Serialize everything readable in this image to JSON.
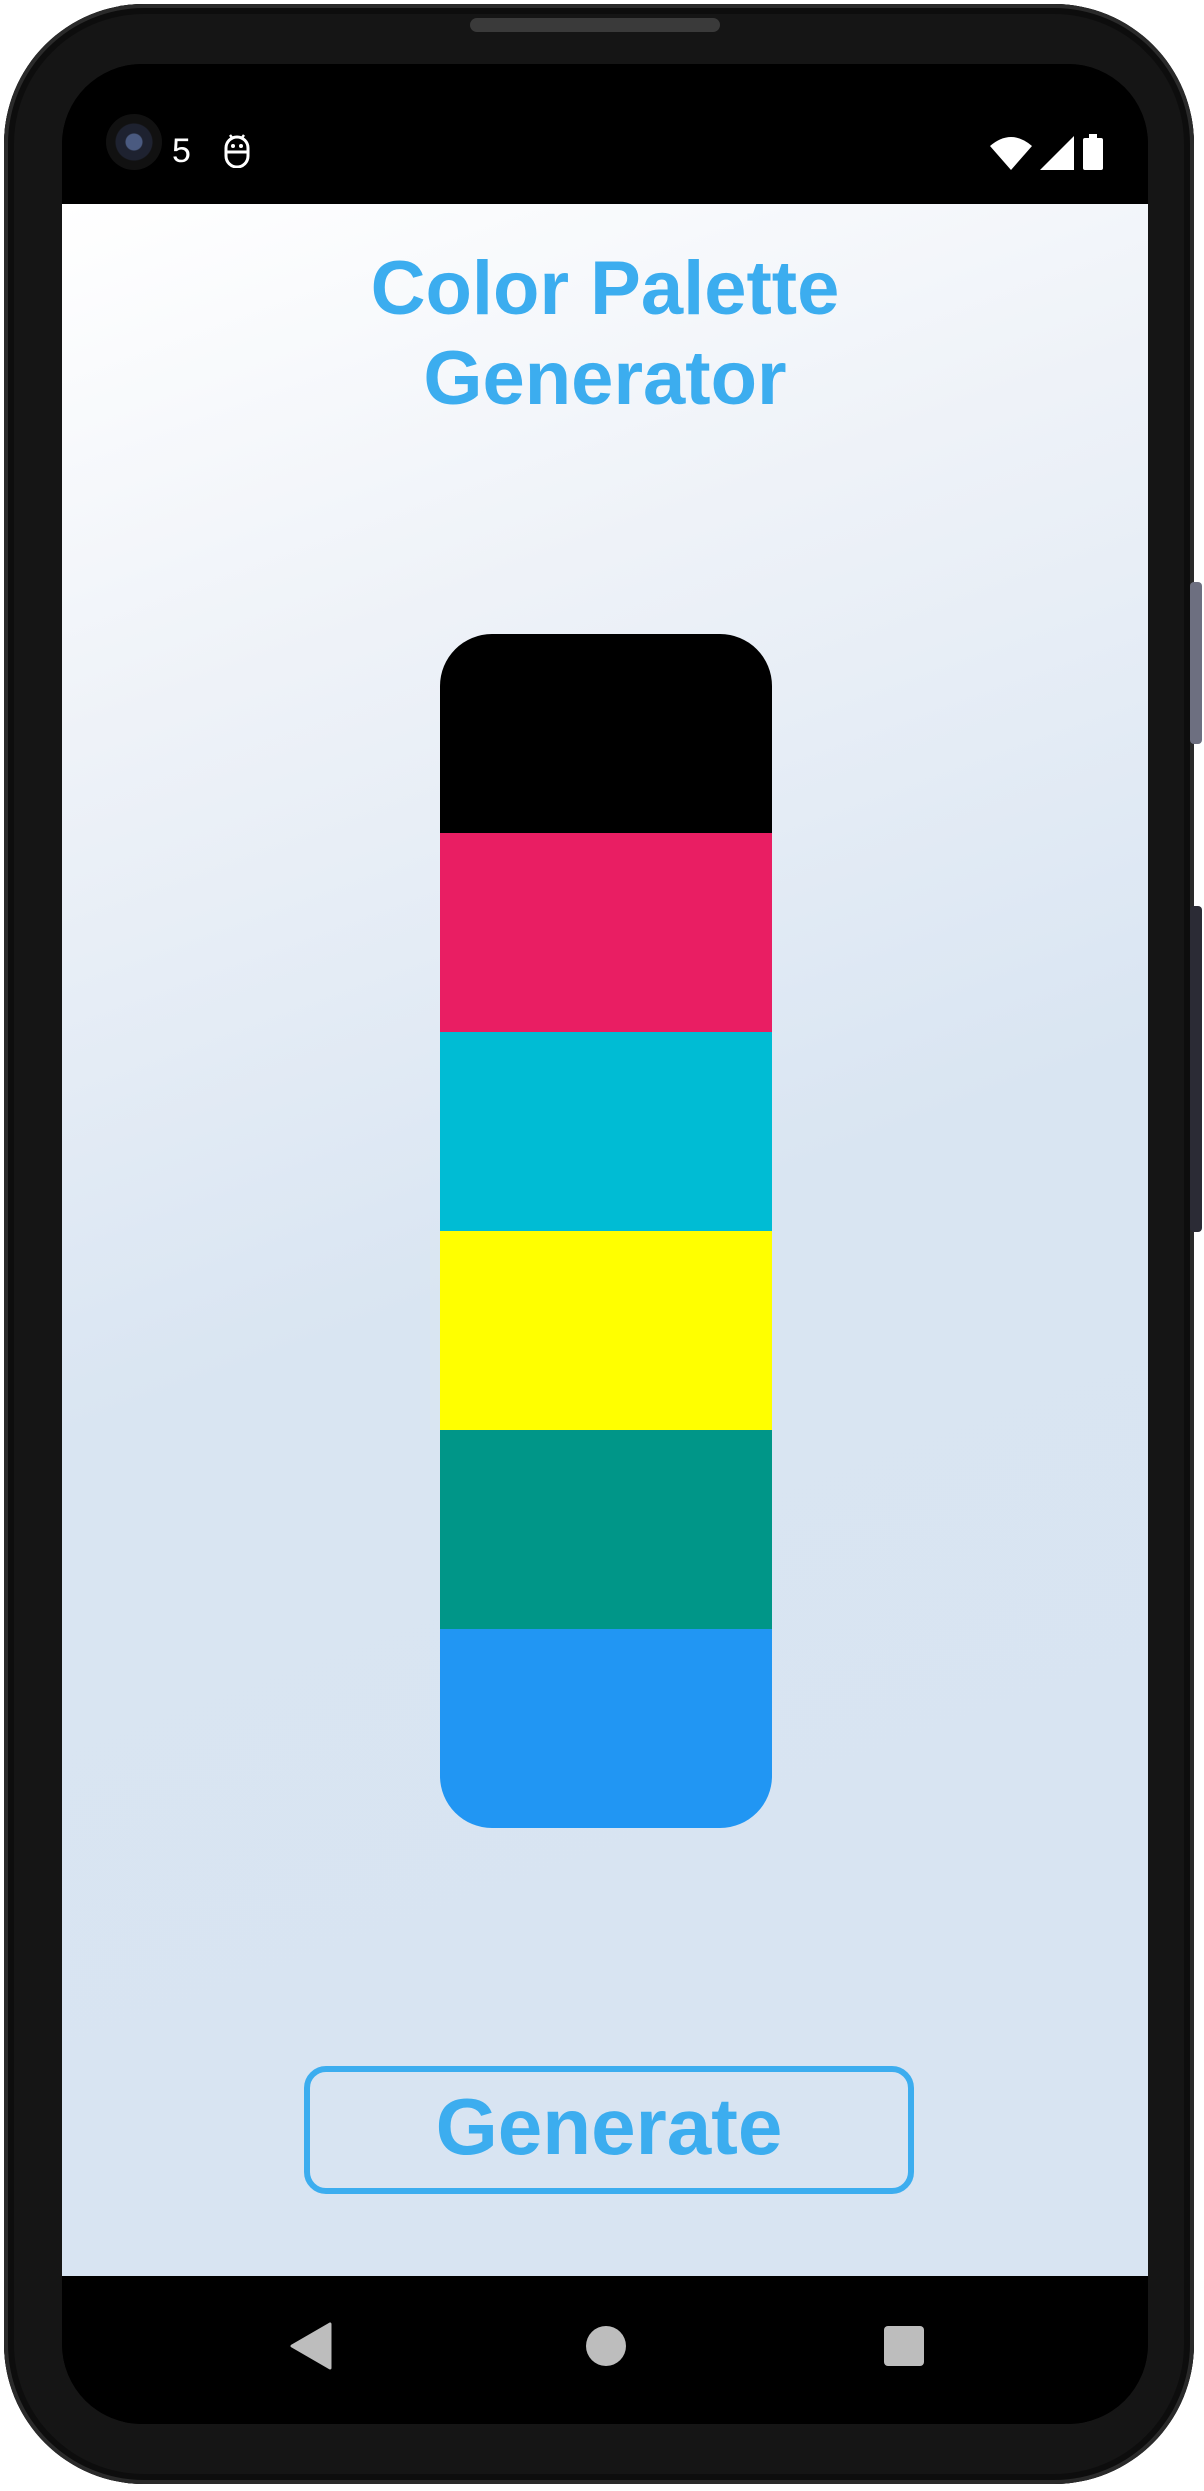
{
  "status_bar": {
    "notification_count": "5",
    "left_icon": "android-debug-icon",
    "right_icons": [
      "wifi-icon",
      "cell-signal-icon",
      "battery-icon"
    ]
  },
  "app": {
    "title_line1": "Color Palette",
    "title_line2": "Generator",
    "accent_color": "#3cadef",
    "palette": {
      "colors": [
        "#000000",
        "#e91e63",
        "#00bcd4",
        "#ffff00",
        "#009688",
        "#2196f3"
      ]
    },
    "generate_button_label": "Generate"
  },
  "nav_bar": {
    "buttons": [
      "back-icon",
      "home-icon",
      "recents-icon"
    ]
  }
}
